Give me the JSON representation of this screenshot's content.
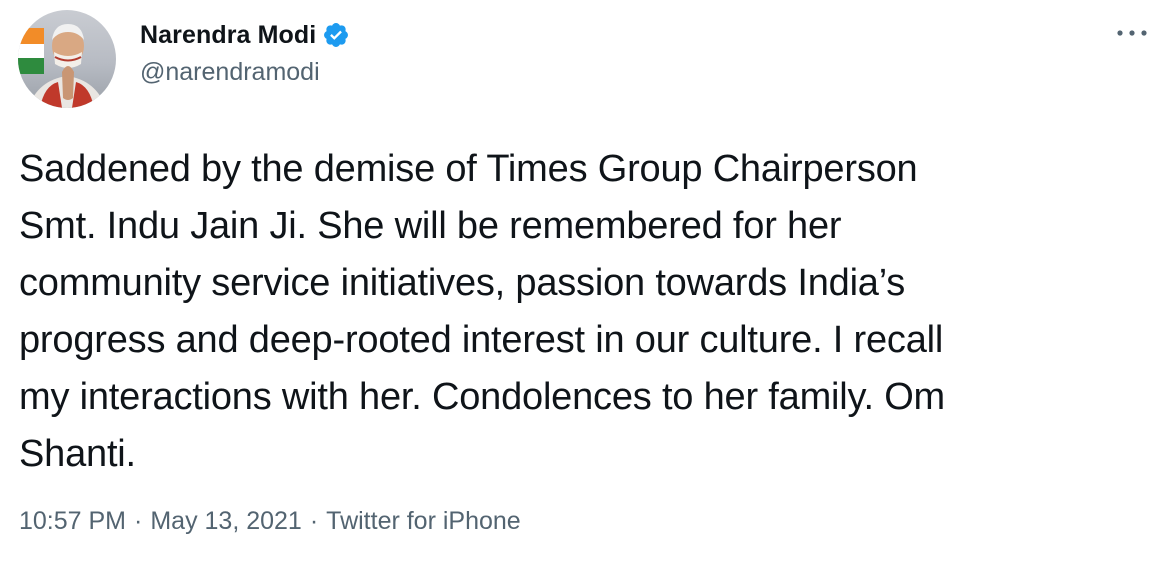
{
  "author": {
    "display_name": "Narendra Modi",
    "handle": "@narendramodi",
    "verified": true
  },
  "tweet": {
    "text": "Saddened by the demise of Times Group Chairperson\nSmt. Indu Jain Ji. She will be remembered for her\ncommunity service initiatives, passion towards India’s\nprogress and deep-rooted interest in our culture. I recall\nmy interactions with her. Condolences to her family. Om\nShanti."
  },
  "meta": {
    "time": "10:57 PM",
    "separator": "·",
    "date": "May 13, 2021",
    "source": "Twitter for iPhone"
  },
  "icons": {
    "verified": "verified-badge-icon",
    "more": "more-options-icon"
  },
  "colors": {
    "verified_blue": "#1d9bf0",
    "secondary_text": "#536471",
    "primary_text": "#0f1419"
  }
}
